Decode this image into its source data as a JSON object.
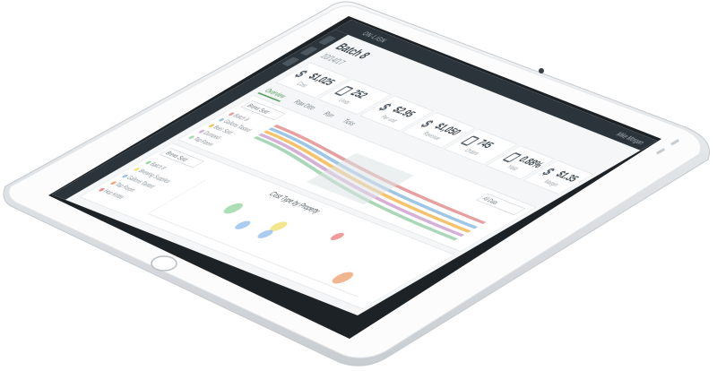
{
  "device": {
    "body_color": "#fafafb",
    "bezel_color": "#eef0f2",
    "screen_border_color": "#1d2226"
  },
  "header": {
    "brand": "ON·LIGN",
    "user_menu": "Mike Morgan"
  },
  "page": {
    "title": "Batch 8",
    "subtitle": "10/14/17",
    "accent_color": "#5aa469"
  },
  "stats": [
    {
      "value": "$1,025",
      "label": "Cost",
      "icon": "dollar-icon"
    },
    {
      "value": "252",
      "label": "Units",
      "icon": "calendar-icon"
    },
    {
      "value": "$2.95",
      "label": "Per unit",
      "icon": "dollar-icon"
    },
    {
      "value": "$1,050",
      "label": "Revenue",
      "icon": "dollar-icon"
    },
    {
      "value": "745",
      "label": "Orders",
      "icon": "document-icon"
    },
    {
      "value": "0.88%",
      "label": "Yield",
      "icon": "calendar-icon"
    },
    {
      "value": "$1.35",
      "label": "Margin",
      "icon": "dollar-icon"
    }
  ],
  "tabs": [
    "Overview",
    "Raw Ditto",
    "Run",
    "Ticks"
  ],
  "filters": {
    "period": "Brews Sold",
    "range": "All Data",
    "scope": "Brews Sold"
  },
  "sankey": {
    "legend": [
      "Batch 8",
      "Gallons Tasted",
      "Beer Sold",
      "Dumped",
      "Tap Room"
    ],
    "colors": [
      "#e6a0a0",
      "#9ec6e6",
      "#f5c36b",
      "#d7b0d9",
      "#a9d8b8"
    ]
  },
  "bubble_chart": {
    "title": "Cost Type by Property",
    "legend": [
      "Batch 8",
      "Brewing Supplies",
      "Gallons Tasted",
      "Tap Room",
      "Hop Kettle"
    ],
    "colors": [
      "#9ed9a8",
      "#f2e27a",
      "#9cc3ef",
      "#f0a97a",
      "#f08a8a"
    ],
    "points": [
      {
        "x": 1,
        "y": 3,
        "size": 14,
        "series": 0
      },
      {
        "x": 2,
        "y": 3,
        "size": 12,
        "series": 1
      },
      {
        "x": 2,
        "y": 2,
        "size": 10,
        "series": 2
      },
      {
        "x": 3,
        "y": 4,
        "size": 8,
        "series": 4
      },
      {
        "x": 4,
        "y": 1,
        "size": 16,
        "series": 3
      },
      {
        "x": 1.5,
        "y": 2,
        "size": 10,
        "series": 2
      }
    ]
  }
}
